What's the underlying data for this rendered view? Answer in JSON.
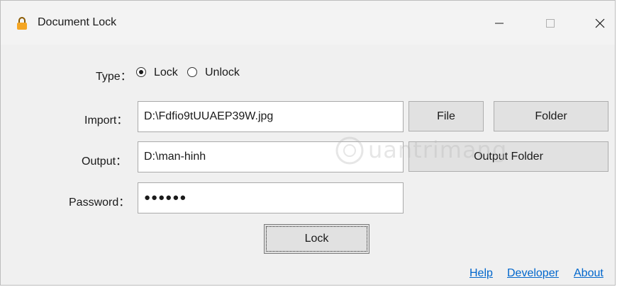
{
  "window": {
    "title": "Document Lock",
    "icon": "padlock-icon",
    "controls": {
      "minimize": "minimize-icon",
      "maximize": "maximize-icon",
      "close": "close-icon"
    }
  },
  "type": {
    "label": "Type：",
    "options": [
      {
        "label": "Lock",
        "selected": true
      },
      {
        "label": "Unlock",
        "selected": false
      }
    ]
  },
  "import": {
    "label": "Import：",
    "value": "D:\\Fdfio9tUUAEP39W.jpg",
    "file_button": "File",
    "folder_button": "Folder"
  },
  "output": {
    "label": "Output：",
    "value": "D:\\man-hinh",
    "folder_button": "Output Folder"
  },
  "password": {
    "label": "Password：",
    "value": "●●●●●●"
  },
  "action": {
    "label": "Lock"
  },
  "footer": {
    "links": [
      "Help",
      "Developer",
      "About"
    ]
  },
  "watermark": {
    "text": "uantrimang"
  },
  "colors": {
    "link": "#0066cc",
    "button": "#e1e1e1",
    "lock_icon": "#f5a623"
  }
}
